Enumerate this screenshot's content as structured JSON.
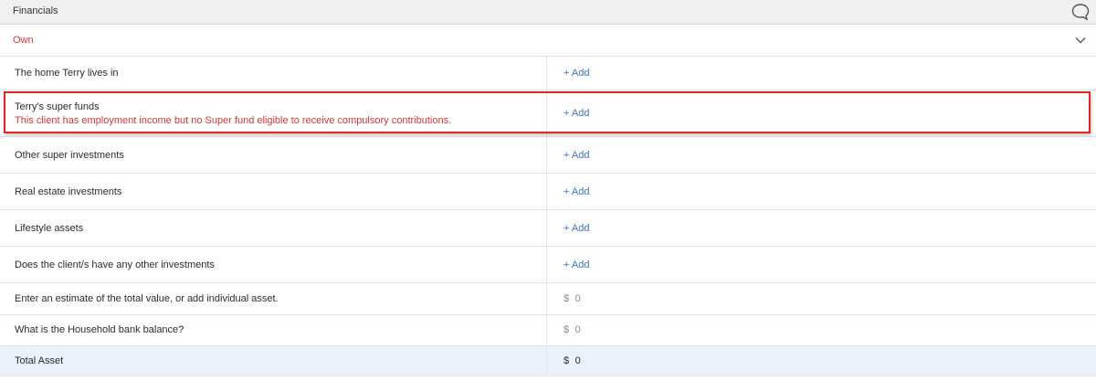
{
  "header": {
    "title": "Financials",
    "icon": "chat-bubble-icon"
  },
  "own": {
    "label": "Own",
    "icon": "chevron-down-icon"
  },
  "rows": [
    {
      "label": "The home Terry lives in",
      "action": "+ Add"
    },
    {
      "label": "Terry's super funds",
      "warning": "This client has employment income but no Super fund eligible to receive compulsory contributions.",
      "action": "+ Add"
    },
    {
      "label": "Other super investments",
      "action": "+ Add"
    },
    {
      "label": "Real estate investments",
      "action": "+ Add"
    },
    {
      "label": "Lifestyle assets",
      "action": "+ Add"
    },
    {
      "label": "Does the client/s have any other investments",
      "action": "+ Add"
    },
    {
      "label": "Enter an estimate of the total value, or add individual asset.",
      "currency": "$",
      "value": "0"
    },
    {
      "label": "What is the Household bank balance?",
      "currency": "$",
      "value": "0"
    }
  ],
  "total": {
    "label": "Total Asset",
    "currency": "$",
    "value": "0"
  },
  "colors": {
    "accent_red": "#d9362f",
    "link_blue": "#3a73c4",
    "total_bg": "#eaf1fa"
  }
}
